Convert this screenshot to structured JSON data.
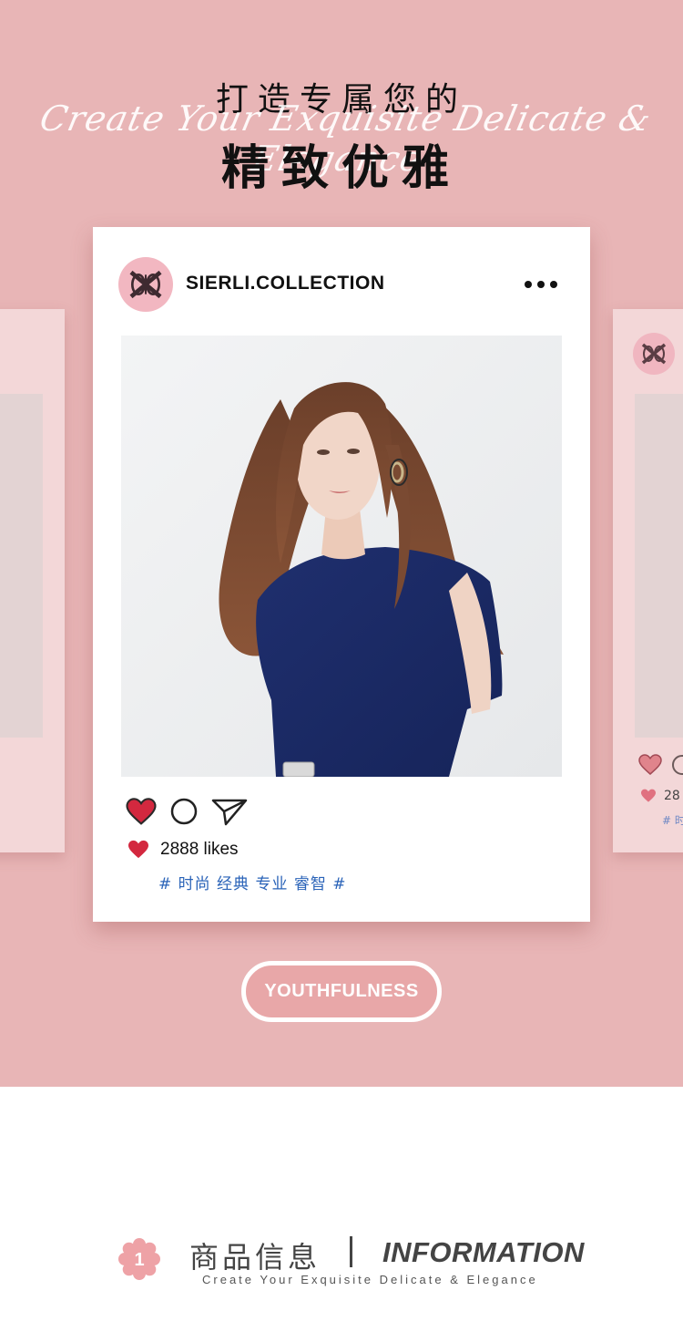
{
  "header": {
    "title_top": "打造专属您的",
    "script_line": "Create Your Exquisite Delicate & Elegance",
    "title_main": "精致优雅"
  },
  "post": {
    "account_name": "SIERLI.COLLECTION",
    "likes": "2888 likes",
    "hashtags": "# 时尚 经典 专业 睿智 #",
    "icons": [
      "heart-icon",
      "comment-icon",
      "share-icon",
      "more-icon",
      "logo-icon"
    ]
  },
  "side_card_right": {
    "likes_partial": "28",
    "tags_partial": "# 时"
  },
  "badge": {
    "label": "YOUTHFULNESS"
  },
  "info_section": {
    "number": "1",
    "title_cn": "商品信息",
    "title_en": "INFORMATION",
    "subtitle": "Create Your Exquisite Delicate & Elegance"
  },
  "colors": {
    "background_pink": "#e8b5b6",
    "card_white": "#ffffff",
    "heart_red": "#d3283f",
    "hashtag_blue": "#2a63b8",
    "flower_pink": "#eea2a6"
  }
}
